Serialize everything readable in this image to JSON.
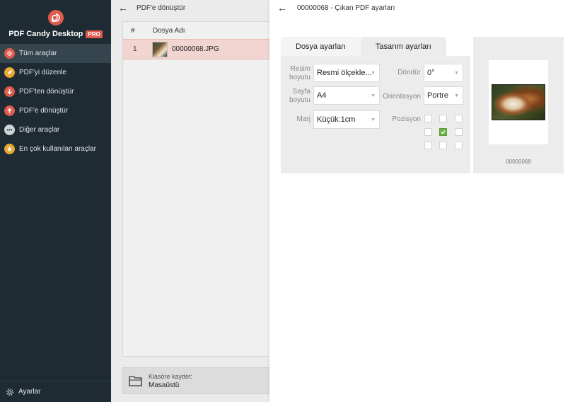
{
  "app": {
    "name": "PDF Candy Desktop",
    "badge": "PRO"
  },
  "sidebar": {
    "items": [
      {
        "label": "Tüm araçlar",
        "icon": "spiral-icon",
        "color": "#e05a4e",
        "active": true
      },
      {
        "label": "PDF'yi düzenle",
        "icon": "pencil-icon",
        "color": "#e8a832",
        "active": false
      },
      {
        "label": "PDF'ten dönüştür",
        "icon": "arrow-down-icon",
        "color": "#e05a4e",
        "active": false
      },
      {
        "label": "PDF'e dönüştür",
        "icon": "arrow-up-icon",
        "color": "#e05a4e",
        "active": false
      },
      {
        "label": "Diğer araçlar",
        "icon": "dots-icon",
        "color": "#cfd4d7",
        "active": false
      },
      {
        "label": "En çok kullanılan araçlar",
        "icon": "star-icon",
        "color": "#e8a832",
        "active": false
      }
    ],
    "footer_label": "Ayarlar"
  },
  "middle": {
    "title": "PDF'e dönüştür",
    "columns": [
      "#",
      "Dosya Adı"
    ],
    "rows": [
      {
        "num": "1",
        "name": "00000068.JPG"
      }
    ],
    "save_label": "Klasöre kaydet:",
    "save_value": "Masaüstü"
  },
  "right": {
    "title": "00000068 - Çıkan PDF ayarları",
    "tabs": [
      "Dosya ayarları",
      "Tasarım ayarları"
    ],
    "active_tab": 1,
    "fields": {
      "image_size_label_1": "Resim",
      "image_size_label_2": "boyutu",
      "image_size_value": "Resmi ölçekle...",
      "page_size_label_1": "Sayfa",
      "page_size_label_2": "boyutu",
      "page_size_value": "A4",
      "margin_label": "Marj",
      "margin_value": "Küçük:1cm",
      "rotate_label": "Döndür",
      "rotate_value": "0°",
      "orientation_label": "Orientasyon",
      "orientation_value": "Portre",
      "position_label": "Pozisyon"
    },
    "position_selected": "center",
    "preview_caption": "00000068"
  },
  "colors": {
    "accent": "#e05a4e",
    "sidebar_bg": "#1e2b32",
    "selected_row": "#f2d5d1",
    "checkbox_green": "#6bb34a"
  }
}
